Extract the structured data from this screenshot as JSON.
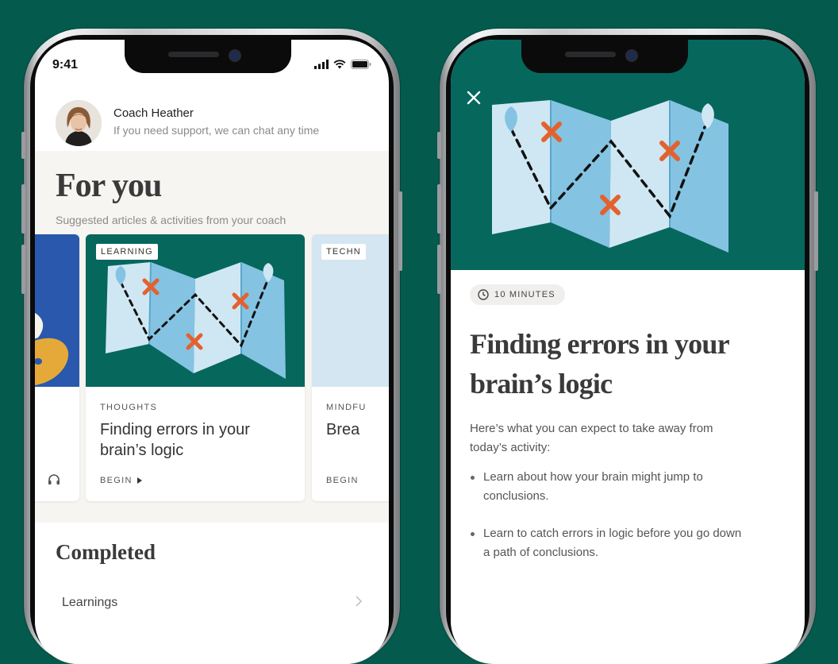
{
  "status": {
    "time": "9:41"
  },
  "coach": {
    "name": "Coach Heather",
    "subtitle": "If you need support, we can chat any time"
  },
  "for_you": {
    "title": "For you",
    "subtitle": "Suggested articles & activities from your coach",
    "cards": [
      {
        "tag": "LEARNING",
        "category": "THOUGHTS",
        "title": "Finding errors in your brain’s logic",
        "cta": "BEGIN"
      },
      {
        "tag": "TECHN",
        "category": "MINDFU",
        "title": "Brea",
        "cta": "BEGIN"
      }
    ]
  },
  "completed": {
    "title": "Completed",
    "items": [
      {
        "label": "Learnings"
      }
    ]
  },
  "activity": {
    "duration": "10 MINUTES",
    "title": "Finding errors in your brain’s logic",
    "intro": "Here’s what you can expect to take away from today’s activity:",
    "bullets": [
      "Learn about how your brain might jump to conclusions.",
      "Learn to catch errors in logic before you go down a path of conclusions."
    ]
  },
  "icons": {
    "signal": "cellular-signal-icon",
    "wifi": "wifi-icon",
    "battery": "battery-icon",
    "headphones": "headphones-icon",
    "play": "play-triangle-icon",
    "chevron": "chevron-right-icon",
    "close": "close-icon",
    "clock": "clock-icon"
  },
  "colors": {
    "background": "#035a4d",
    "hero": "#06675d",
    "map_light": "#cfe7f3",
    "map_mid": "#84c3e2",
    "marker": "#e4612e",
    "card_blue": "#2958ad"
  }
}
